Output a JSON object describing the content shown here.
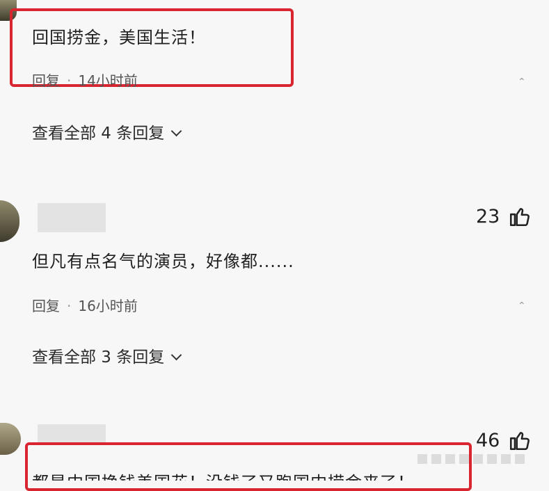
{
  "comments": [
    {
      "text": "回国捞金，美国生活！",
      "reply_label": "回复",
      "separator": "·",
      "time": "14小时前",
      "expand_label": "查看全部 4 条回复"
    },
    {
      "likes": "23",
      "text": "但凡有点名气的演员，好像都......",
      "reply_label": "回复",
      "separator": "·",
      "time": "16小时前",
      "expand_label": "查看全部 3 条回复"
    },
    {
      "likes": "46",
      "text": "都是中国挣钱美国花！没钱了又跑国内捞金来了！"
    }
  ],
  "icons": {
    "like": "thumbs-up-icon",
    "expand": "chevron-down-icon",
    "more": "more-icon"
  },
  "colors": {
    "highlight_border": "#d8252f",
    "background": "#f7f7f7"
  }
}
